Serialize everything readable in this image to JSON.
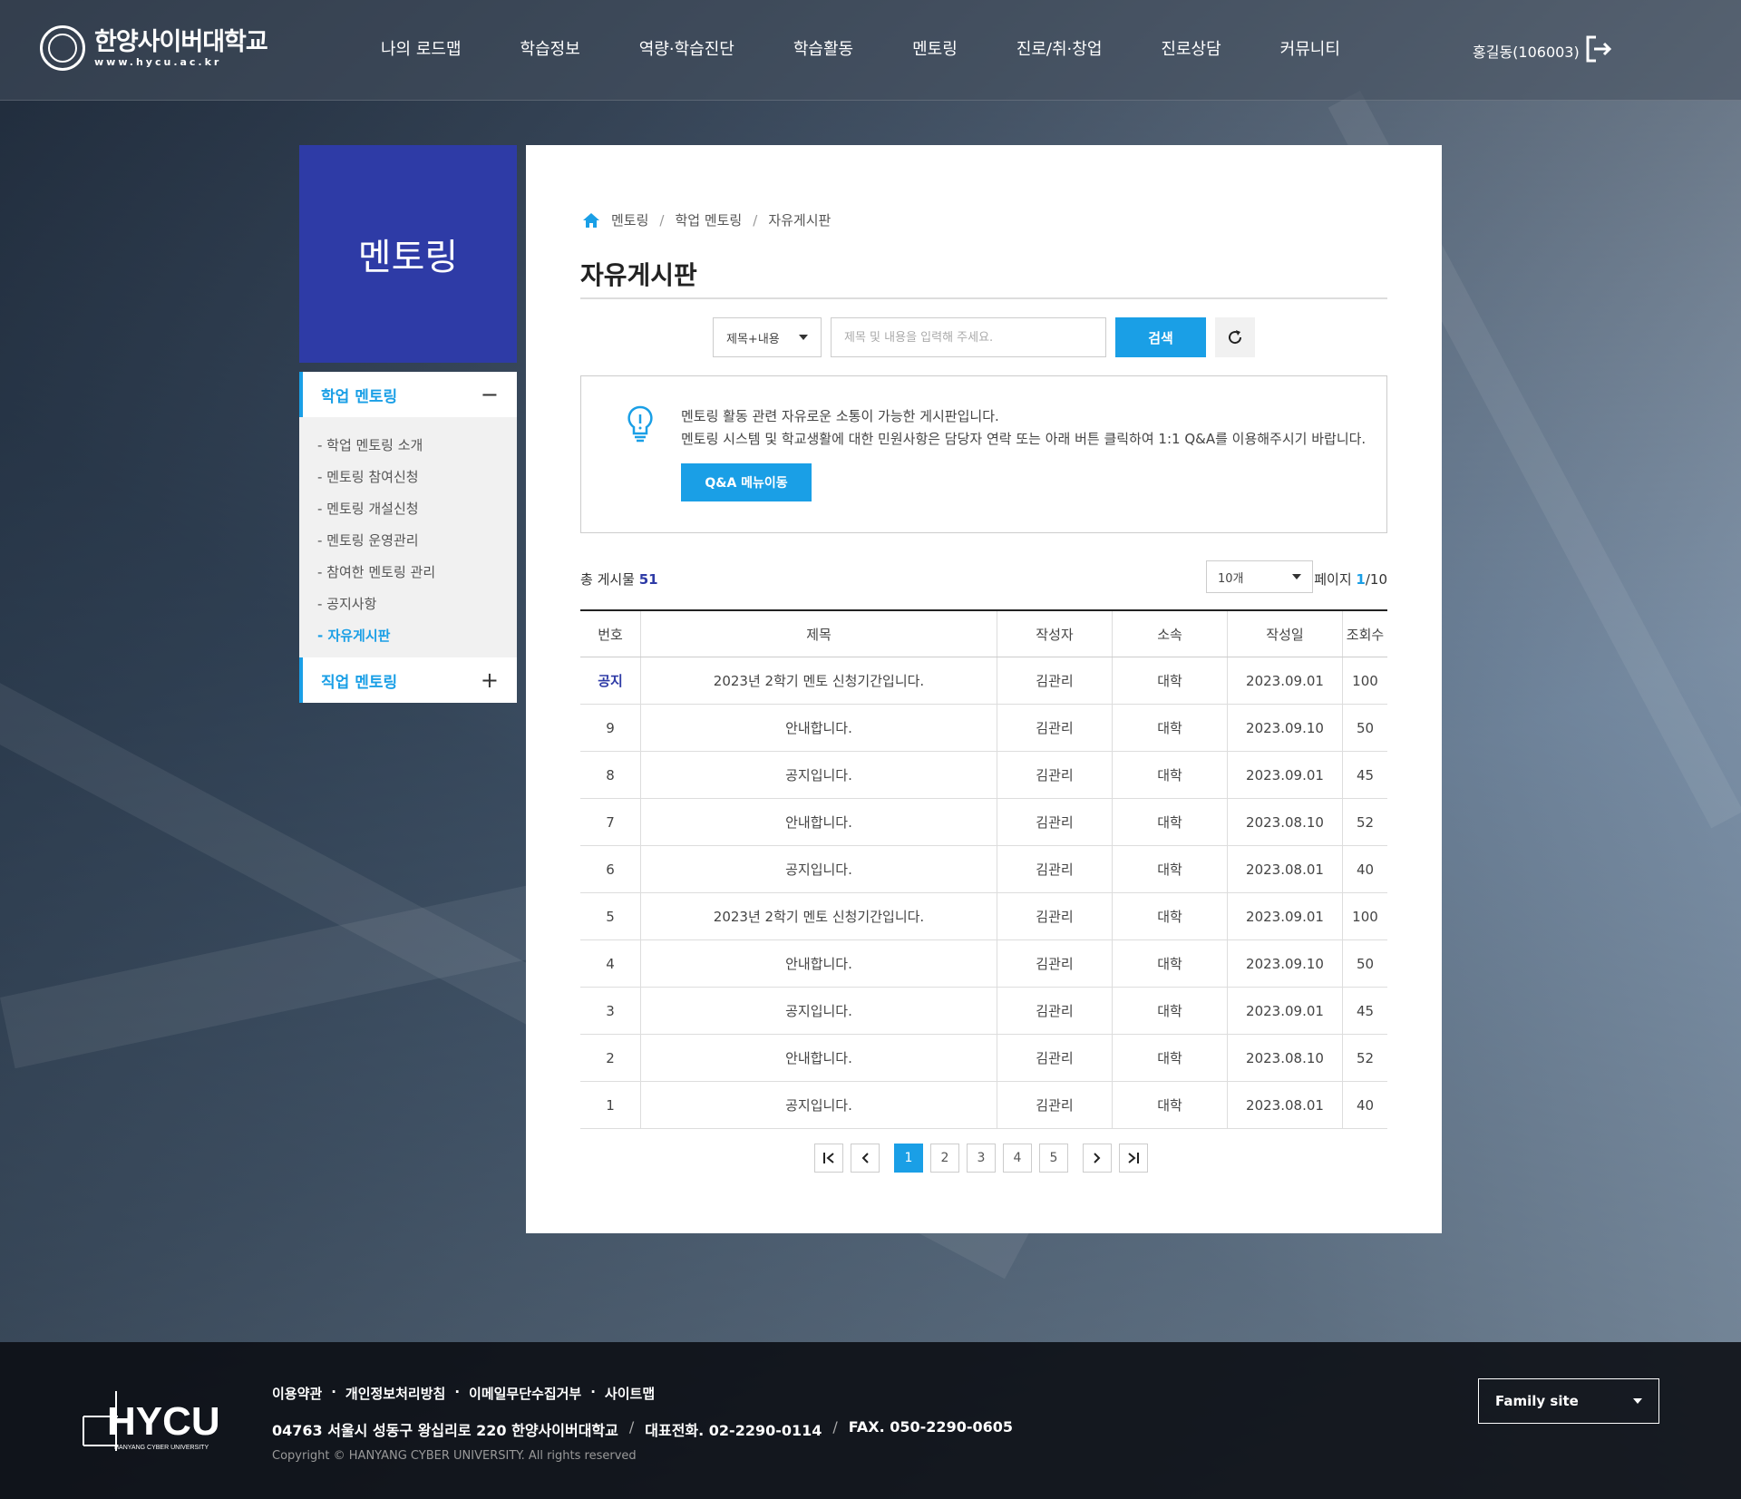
{
  "header": {
    "logo_name": "한양사이버대학교",
    "logo_url": "www.hycu.ac.kr",
    "nav": [
      "나의 로드맵",
      "학습정보",
      "역량·학습진단",
      "학습활동",
      "멘토링",
      "진로/취·창업",
      "진로상담",
      "커뮤니티"
    ],
    "user": "홍길동(106003)"
  },
  "sidebar": {
    "title": "멘토링",
    "group1": "학업 멘토링",
    "group1_toggle": "−",
    "items": [
      "- 학업 멘토링 소개",
      "- 멘토링 참여신청",
      "- 멘토링 개설신청",
      "- 멘토링 운영관리",
      "- 참여한 멘토링 관리",
      "- 공지사항",
      "- 자유게시판"
    ],
    "group2": "직업 멘토링",
    "group2_toggle": "+"
  },
  "breadcrumb": [
    "멘토링",
    "학업 멘토링",
    "자유게시판"
  ],
  "breadcrumb_sep": "/",
  "page_title": "자유게시판",
  "search": {
    "select": "제목+내용",
    "placeholder": "제목 및 내용을 입력해 주세요.",
    "button": "검색"
  },
  "info": {
    "line1": "멘토링 활동 관련 자유로운 소통이 가능한 게시판입니다.",
    "line2": "멘토링 시스템 및 학교생활에 대한 민원사항은 담당자 연락 또는 아래 버튼 클릭하여 1:1 Q&A를 이용해주시기 바랍니다.",
    "button": "Q&A 메뉴이동"
  },
  "list": {
    "total_label": "총 게시물",
    "total": "51",
    "page_size": "10개",
    "page_label": "페이지",
    "page_current": "1",
    "page_total": "/10"
  },
  "table": {
    "headers": [
      "번호",
      "제목",
      "작성자",
      "소속",
      "작성일",
      "조회수"
    ],
    "rows": [
      [
        "공지",
        "2023년 2학기 멘토 신청기간입니다.",
        "김관리",
        "대학",
        "2023.09.01",
        "100"
      ],
      [
        "9",
        "안내합니다.",
        "김관리",
        "대학",
        "2023.09.10",
        "50"
      ],
      [
        "8",
        "공지입니다.",
        "김관리",
        "대학",
        "2023.09.01",
        "45"
      ],
      [
        "7",
        "안내합니다.",
        "김관리",
        "대학",
        "2023.08.10",
        "52"
      ],
      [
        "6",
        "공지입니다.",
        "김관리",
        "대학",
        "2023.08.01",
        "40"
      ],
      [
        "5",
        "2023년 2학기 멘토 신청기간입니다.",
        "김관리",
        "대학",
        "2023.09.01",
        "100"
      ],
      [
        "4",
        "안내합니다.",
        "김관리",
        "대학",
        "2023.09.10",
        "50"
      ],
      [
        "3",
        "공지입니다.",
        "김관리",
        "대학",
        "2023.09.01",
        "45"
      ],
      [
        "2",
        "안내합니다.",
        "김관리",
        "대학",
        "2023.08.10",
        "52"
      ],
      [
        "1",
        "공지입니다.",
        "김관리",
        "대학",
        "2023.08.01",
        "40"
      ]
    ]
  },
  "pagination": [
    "1",
    "2",
    "3",
    "4",
    "5"
  ],
  "footer": {
    "logo": "HYCU",
    "logo_sub": "HANYANG CYBER UNIVERSITY",
    "links": [
      "이용약관",
      "개인정보처리방침",
      "이메일무단수집거부",
      "사이트맵"
    ],
    "link_sep": "·",
    "address": "04763 서울시 성동구 왕십리로 220 한양사이버대학교",
    "tel": "대표전화. 02-2290-0114",
    "fax": "FAX. 050-2290-0605",
    "addr_sep": "/",
    "copyright": "Copyright © HANYANG CYBER UNIVERSITY. All rights reserved",
    "family": "Family site"
  },
  "colors": {
    "brand_blue": "#2e3ba6",
    "accent": "#1a9fe6"
  }
}
